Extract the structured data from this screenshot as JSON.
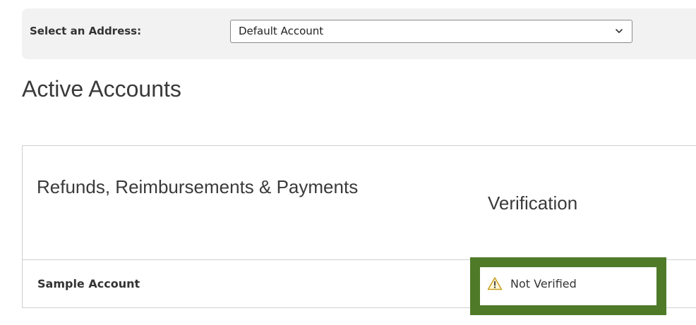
{
  "address_selector": {
    "label": "Select an Address:",
    "selected_value": "Default Account",
    "icon": "chevron-down-icon"
  },
  "page_title": "Active Accounts",
  "table": {
    "headers": [
      "Refunds, Reimbursements & Payments",
      "Verification"
    ],
    "rows": [
      {
        "account": "Sample Account",
        "verification": {
          "status": "Not Verified",
          "icon": "warning-icon",
          "icon_color": "#c9a227"
        }
      }
    ]
  },
  "colors": {
    "highlight_border": "#4f7a28",
    "panel_background": "#f2f2f2",
    "table_border": "#d0d0d0"
  }
}
